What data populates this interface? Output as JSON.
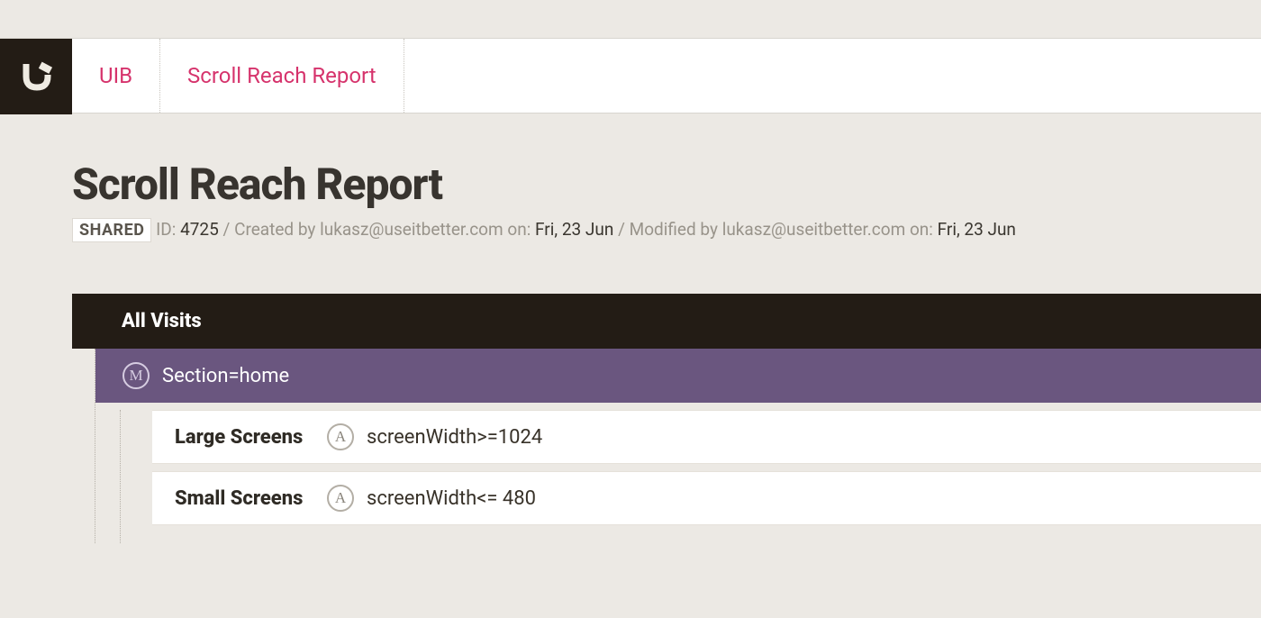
{
  "breadcrumb": {
    "item1": "UIB",
    "item2": "Scroll Reach Report"
  },
  "header": {
    "title": "Scroll Reach Report",
    "shared_badge": "SHARED",
    "id_label": "ID: ",
    "id_value": "4725",
    "created_label": "Created by",
    "created_by": "lukasz@useitbetter.com",
    "on_label": "on:",
    "created_on": "Fri, 23 Jun",
    "modified_label": "Modified by",
    "modified_by": "lukasz@useitbetter.com",
    "modified_on": "Fri, 23 Jun"
  },
  "tree": {
    "root_label": "All Visits",
    "section": {
      "badge": "M",
      "label": "Section=home"
    },
    "segments": [
      {
        "badge": "A",
        "name": "Large Screens",
        "formula": "screenWidth>=1024"
      },
      {
        "badge": "A",
        "name": "Small Screens",
        "formula": "screenWidth<= 480"
      }
    ]
  }
}
